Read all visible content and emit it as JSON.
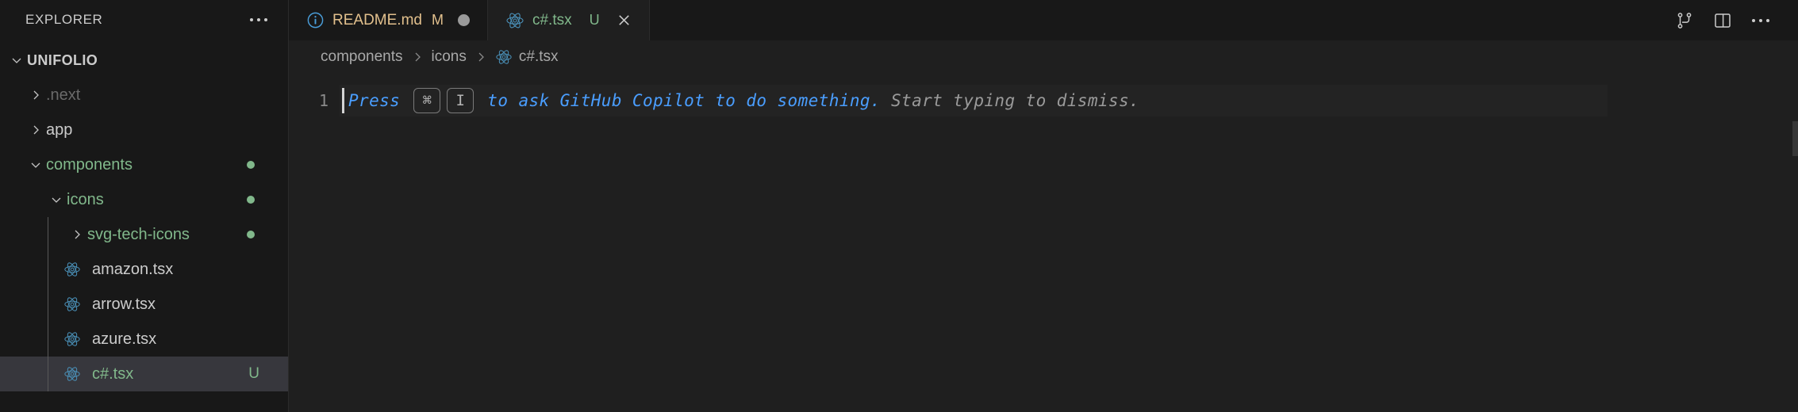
{
  "sidebar": {
    "title": "EXPLORER",
    "more_actions_label": "...",
    "root": {
      "label": "UNIFOLIO",
      "expanded": true
    },
    "items": [
      {
        "label": ".next",
        "type": "folder",
        "expanded": false,
        "indent": 1,
        "color": "dim",
        "badge": "",
        "icon": "chevron-right-icon"
      },
      {
        "label": "app",
        "type": "folder",
        "expanded": false,
        "indent": 1,
        "color": "default",
        "badge": "",
        "icon": "chevron-right-icon"
      },
      {
        "label": "components",
        "type": "folder",
        "expanded": true,
        "indent": 1,
        "color": "green",
        "badge": "dot",
        "icon": "chevron-down-icon"
      },
      {
        "label": "icons",
        "type": "folder",
        "expanded": true,
        "indent": 2,
        "color": "green",
        "badge": "dot",
        "icon": "chevron-down-icon"
      },
      {
        "label": "svg-tech-icons",
        "type": "folder",
        "expanded": false,
        "indent": 3,
        "color": "green",
        "badge": "dot",
        "icon": "chevron-right-icon"
      },
      {
        "label": "amazon.tsx",
        "type": "file",
        "indent": 3,
        "color": "default",
        "badge": "",
        "icon": "react-icon"
      },
      {
        "label": "arrow.tsx",
        "type": "file",
        "indent": 3,
        "color": "default",
        "badge": "",
        "icon": "react-icon"
      },
      {
        "label": "azure.tsx",
        "type": "file",
        "indent": 3,
        "color": "default",
        "badge": "",
        "icon": "react-icon"
      },
      {
        "label": "c#.tsx",
        "type": "file",
        "indent": 3,
        "color": "green",
        "badge": "U",
        "icon": "react-icon",
        "selected": true
      }
    ]
  },
  "tabs": [
    {
      "label": "README.md",
      "icon": "info-icon",
      "status": "M",
      "dirty": true,
      "active": false,
      "label_color": "readme"
    },
    {
      "label": "c#.tsx",
      "icon": "react-icon",
      "status": "U",
      "dirty": false,
      "active": true,
      "label_color": "green",
      "close": "×"
    }
  ],
  "tabbar_actions": [
    {
      "name": "source-control-split-icon",
      "label": ""
    },
    {
      "name": "split-editor-icon",
      "label": ""
    },
    {
      "name": "more-actions-icon",
      "label": "..."
    }
  ],
  "breadcrumb": [
    {
      "label": "components",
      "icon": ""
    },
    {
      "label": "icons",
      "icon": ""
    },
    {
      "label": "c#.tsx",
      "icon": "react-icon"
    }
  ],
  "editor": {
    "line_number": "1",
    "ghost_prefix": "Press ",
    "key1": "⌘",
    "key2": "I",
    "ghost_middle": " to ask GitHub Copilot to do something.",
    "ghost_suffix": " Start typing to dismiss."
  },
  "colors": {
    "accent_blue": "#4a9eff",
    "git_untracked_green": "#81b88b",
    "git_modified_tan": "#e2c08d",
    "selection_bg": "#37373d",
    "sidebar_bg": "#181818",
    "editor_bg": "#1f1f1f"
  }
}
